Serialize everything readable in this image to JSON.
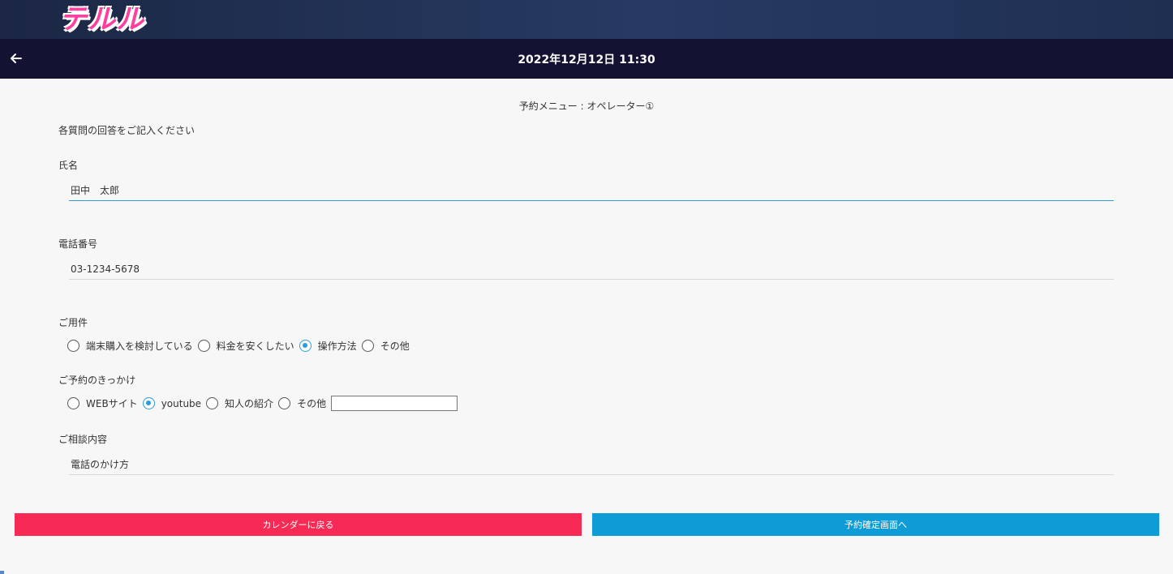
{
  "header": {
    "logo_text": "テルル",
    "datetime": "2022年12月12日 11:30"
  },
  "form": {
    "menu_title": "予約メニュー : オペレーター①",
    "instruction": "各質問の回答をご記入ください",
    "name": {
      "label": "氏名",
      "value": "田中　太郎"
    },
    "phone": {
      "label": "電話番号",
      "value": "03-1234-5678"
    },
    "purpose": {
      "label": "ご用件",
      "options": [
        "端末購入を検討している",
        "料金を安くしたい",
        "操作方法",
        "その他"
      ],
      "selected": "操作方法"
    },
    "trigger": {
      "label": "ご予約のきっかけ",
      "options": [
        "WEBサイト",
        "youtube",
        "知人の紹介",
        "その他"
      ],
      "selected": "youtube",
      "other_value": ""
    },
    "consultation": {
      "label": "ご相談内容",
      "value": "電話のかけ方"
    }
  },
  "buttons": {
    "back_label": "カレンダーに戻る",
    "confirm_label": "予約確定画面へ"
  },
  "colors": {
    "accent": "#2a9fd6",
    "back_button": "#f72a55",
    "confirm_button": "#0e9bd6",
    "navbar": "#141232",
    "logo": "#ff3f9e"
  }
}
